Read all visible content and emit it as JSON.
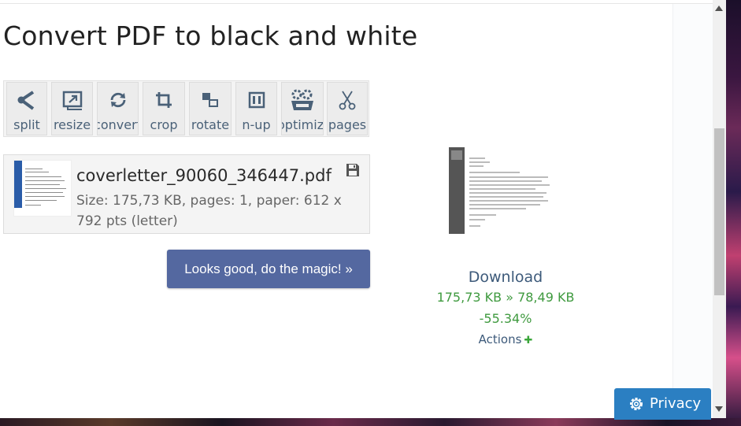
{
  "page": {
    "title": "Convert PDF to black and white"
  },
  "toolbar": {
    "tools": [
      {
        "label": "split",
        "icon": "split-icon"
      },
      {
        "label": "resize",
        "icon": "resize-icon"
      },
      {
        "label": "convert",
        "icon": "convert-icon"
      },
      {
        "label": "crop",
        "icon": "crop-icon"
      },
      {
        "label": "rotate",
        "icon": "rotate-icon"
      },
      {
        "label": "n-up",
        "icon": "n-up-icon"
      },
      {
        "label": "optimize",
        "icon": "optimize-icon"
      },
      {
        "label": "pages",
        "icon": "scissors-icon"
      }
    ]
  },
  "file": {
    "name": "coverletter_90060_346447.pdf",
    "meta": "Size: 175,73 KB, pages: 1, paper: 612 x 792 pts (letter)"
  },
  "action": {
    "magic_label": "Looks good, do the magic! »"
  },
  "result": {
    "download_label": "Download",
    "size_change": "175,73 KB » 78,49 KB",
    "percent": "-55.34%",
    "actions_label": "Actions",
    "actions_icon": "plus-icon"
  },
  "privacy": {
    "label": "Privacy",
    "icon": "gear-icon"
  },
  "colors": {
    "accent_button": "#5468a0",
    "privacy_button": "#2b7fc2",
    "success_text": "#3f9a3f",
    "link_text": "#3d5a7a"
  }
}
